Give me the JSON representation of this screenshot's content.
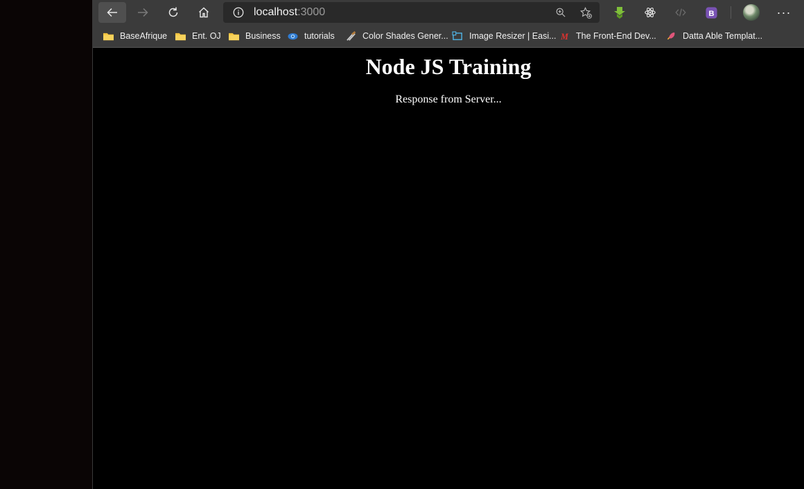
{
  "browser": {
    "url_host": "localhost",
    "url_port": ":3000",
    "more_label": "···"
  },
  "bookmarks": [
    {
      "label": "BaseAfrique",
      "icon": "folder-icon"
    },
    {
      "label": "Ent. OJ",
      "icon": "folder-icon"
    },
    {
      "label": "Business",
      "icon": "folder-icon"
    },
    {
      "label": "tutorials",
      "icon": "eye-icon"
    },
    {
      "label": "Color Shades Gener...",
      "icon": "tools-icon"
    },
    {
      "label": "Image Resizer | Easi...",
      "icon": "resize-icon"
    },
    {
      "label": "The Front-End Dev...",
      "icon": "m-logo-icon"
    },
    {
      "label": "Datta Able Templat...",
      "icon": "rocket-icon"
    }
  ],
  "page": {
    "heading": "Node JS Training",
    "body_text": "Response from Server..."
  },
  "colors": {
    "toolbar_bg": "#3b3b3b",
    "omnibox_bg": "#292929",
    "page_bg": "#000000",
    "folder": "#f3c33f",
    "download_ext": "#7fbf3a",
    "bootstrap_ext": "#7952b3"
  }
}
